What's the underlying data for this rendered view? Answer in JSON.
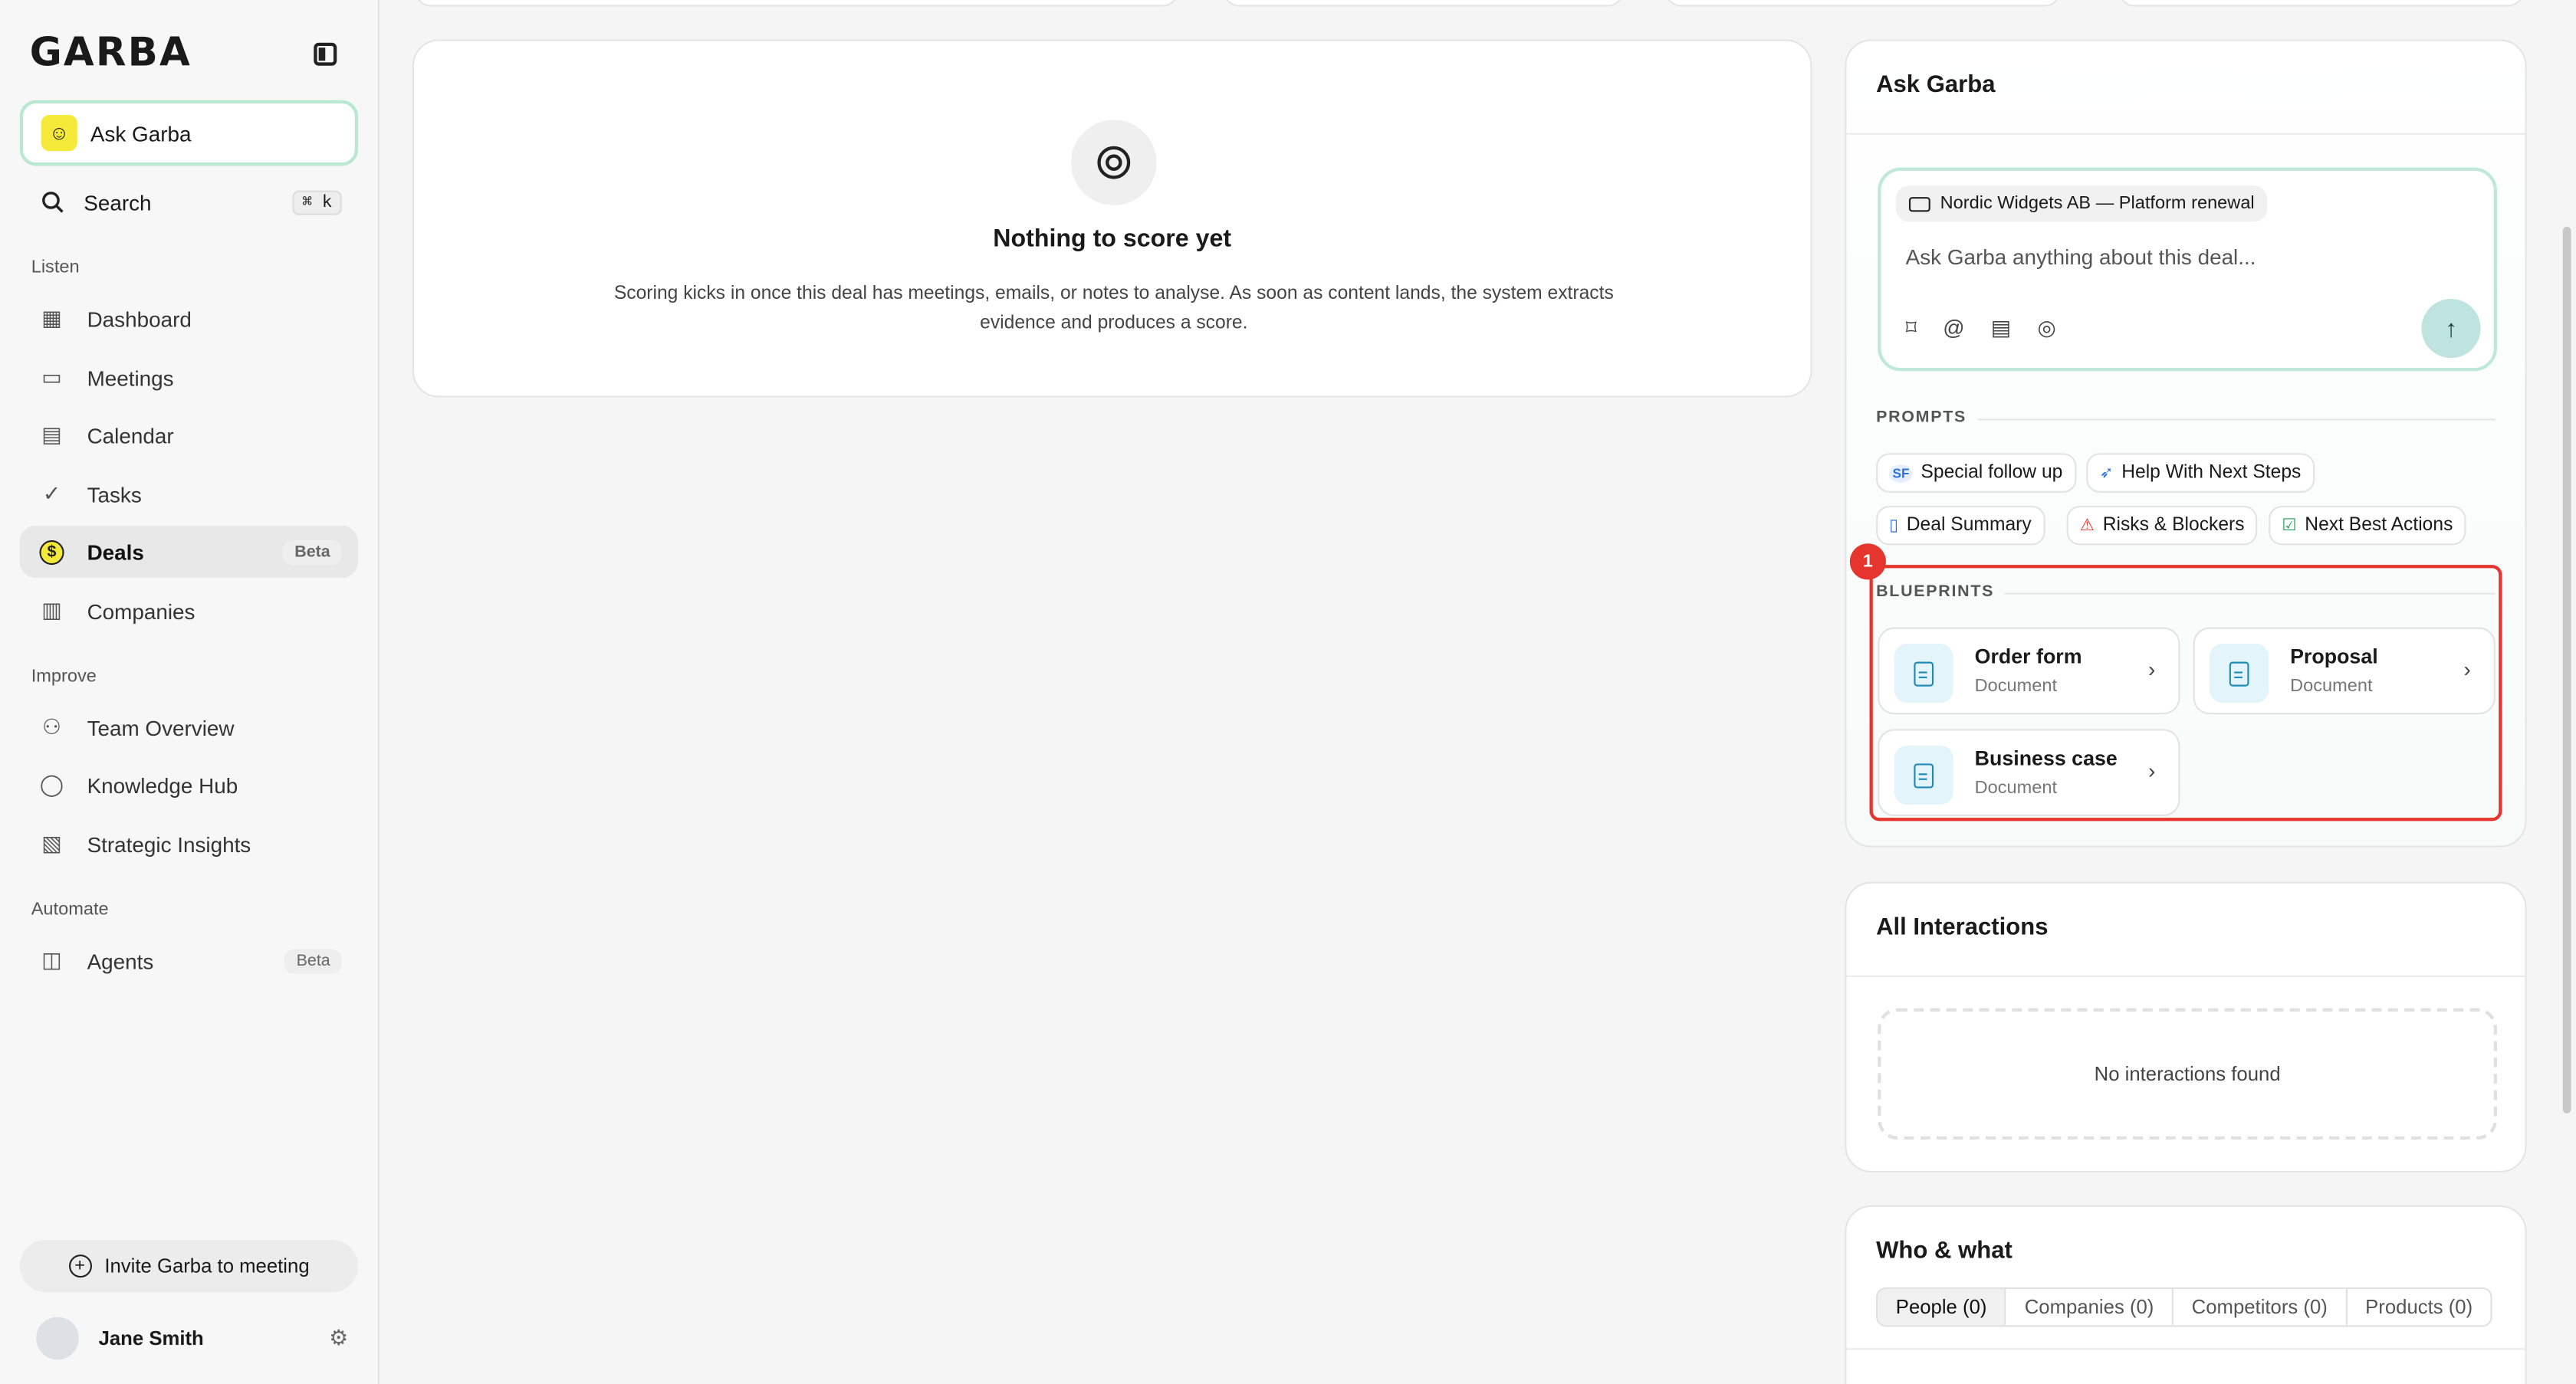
{
  "sidebar": {
    "logo": "GARBA",
    "ask_label": "Ask Garba",
    "search_label": "Search",
    "search_shortcut": "⌘ k",
    "sections": {
      "listen": "Listen",
      "improve": "Improve",
      "automate": "Automate"
    },
    "items": {
      "dashboard": "Dashboard",
      "meetings": "Meetings",
      "calendar": "Calendar",
      "tasks": "Tasks",
      "deals": "Deals",
      "deals_badge": "Beta",
      "companies": "Companies",
      "team_overview": "Team Overview",
      "knowledge_hub": "Knowledge Hub",
      "strategic_insights": "Strategic Insights",
      "agents": "Agents",
      "agents_badge": "Beta"
    },
    "invite_label": "Invite Garba to meeting",
    "user_name": "Jane Smith"
  },
  "score": {
    "title": "Nothing to score yet",
    "description": "Scoring kicks in once this deal has meetings, emails, or notes to analyse. As soon as content lands, the system extracts evidence and produces a score."
  },
  "ask_panel": {
    "title": "Ask Garba",
    "context_chip": "Nordic Widgets AB — Platform renewal",
    "placeholder": "Ask Garba anything about this deal...",
    "prompts_label": "PROMPTS",
    "prompts": [
      {
        "icon": "SF",
        "label": "Special follow up"
      },
      {
        "icon": "rocket-icon",
        "label": "Help With Next Steps"
      },
      {
        "icon": "document-icon",
        "label": "Deal Summary"
      },
      {
        "icon": "warning-icon",
        "label": "Risks & Blockers"
      },
      {
        "icon": "checklist-icon",
        "label": "Next Best Actions"
      }
    ],
    "blueprints_label": "BLUEPRINTS",
    "blueprints": [
      {
        "title": "Order form",
        "type": "Document"
      },
      {
        "title": "Proposal",
        "type": "Document"
      },
      {
        "title": "Business case",
        "type": "Document"
      }
    ],
    "annotation_number": "1"
  },
  "interactions": {
    "title": "All Interactions",
    "empty": "No interactions found"
  },
  "who_what": {
    "title": "Who & what",
    "tabs": [
      "People (0)",
      "Companies (0)",
      "Competitors (0)",
      "Products (0)"
    ]
  },
  "colors": {
    "accent_green_border": "#bfe8da",
    "highlight_red": "#e5352e",
    "smile_yellow": "#f5ea3a"
  }
}
